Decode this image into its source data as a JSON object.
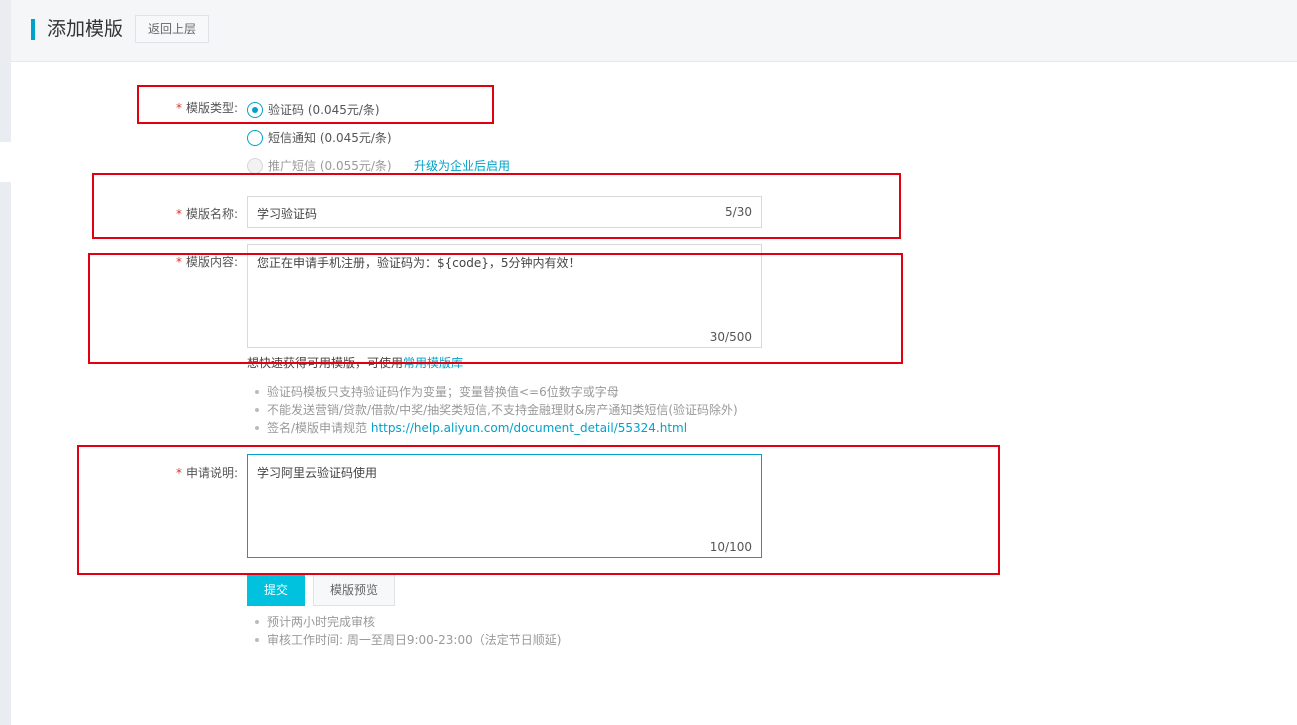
{
  "header": {
    "title": "添加模版",
    "back_label": "返回上层"
  },
  "form": {
    "type": {
      "label": "模版类型:",
      "options": [
        {
          "label": "验证码 (0.045元/条)",
          "selected": true,
          "disabled": false
        },
        {
          "label": "短信通知 (0.045元/条)",
          "selected": false,
          "disabled": false
        },
        {
          "label": "推广短信 (0.055元/条)",
          "selected": false,
          "disabled": true
        }
      ],
      "upgrade_link": "升级为企业后启用"
    },
    "name": {
      "label": "模版名称:",
      "value": "学习验证码",
      "count": "5/30"
    },
    "content": {
      "label": "模版内容:",
      "value": "您正在申请手机注册，验证码为：${code}，5分钟内有效！",
      "count": "30/500",
      "hint_text": "想快速获得可用模版，可使用",
      "hint_link": "常用模版库"
    },
    "notes": [
      "验证码模板只支持验证码作为变量；变量替换值<=6位数字或字母",
      "不能发送营销/贷款/借款/中奖/抽奖类短信,不支持金融理财&房产通知类短信(验证码除外)"
    ],
    "notes_rule_text": "签名/模版申请规范 ",
    "notes_rule_link": "https://help.aliyun.com/document_detail/55324.html",
    "description": {
      "label": "申请说明:",
      "value": "学习阿里云验证码使用",
      "count": "10/100"
    },
    "submit_label": "提交",
    "preview_label": "模版预览",
    "review_notes": [
      "预计两小时完成审核",
      "审核工作时间: 周一至周日9:00-23:00（法定节日顺延)"
    ]
  },
  "colors": {
    "accent": "#00a2ca",
    "submit": "#00c1de",
    "required": "#d9342b",
    "annotation": "#e0000f"
  }
}
